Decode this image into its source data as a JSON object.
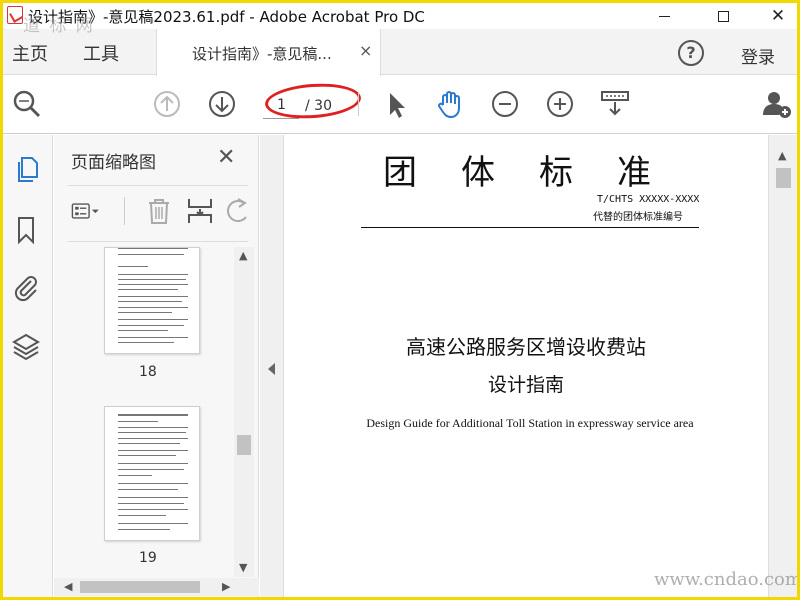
{
  "window": {
    "title": "设计指南》-意见稿2023.61.pdf - Adobe Acrobat Pro DC",
    "minimize_glyph": "—",
    "close_glyph": "✕"
  },
  "tabs": {
    "home_label": "主页",
    "tools_label": "工具",
    "document_label": "设计指南》-意见稿...",
    "document_close": "×",
    "help_glyph": "?",
    "login_label": "登录"
  },
  "toolbar": {
    "current_page": "1",
    "total_pages": "/ 30",
    "icons": [
      "search-zoom-icon",
      "previous-page-icon",
      "next-page-icon",
      "select-cursor-icon",
      "hand-tool-icon",
      "zoom-out-icon",
      "zoom-in-icon",
      "page-display-icon",
      "share-user-icon"
    ],
    "accent_color": "#2a7ad1"
  },
  "sidebar": {
    "rail_icons": [
      "page-thumbnails-icon",
      "bookmarks-icon",
      "attachments-icon",
      "layers-icon"
    ],
    "panel_title": "页面缩略图",
    "panel_close": "✕",
    "thumbnails": [
      {
        "page_number": "18"
      },
      {
        "page_number": "19"
      }
    ]
  },
  "document": {
    "heading": "团体标准",
    "standard_code": "T/CHTS XXXXX-XXXX",
    "replaces_label": "代替的团体标准编号",
    "title_line1": "高速公路服务区增设收费站",
    "title_line2": "设计指南",
    "english_title": "Design Guide for Additional Toll Station in expressway service area"
  },
  "watermarks": {
    "top": "道 标 网",
    "bottom": "www.cndao.com"
  },
  "colors": {
    "frame": "#f0d800",
    "annotation": "#e02020"
  }
}
